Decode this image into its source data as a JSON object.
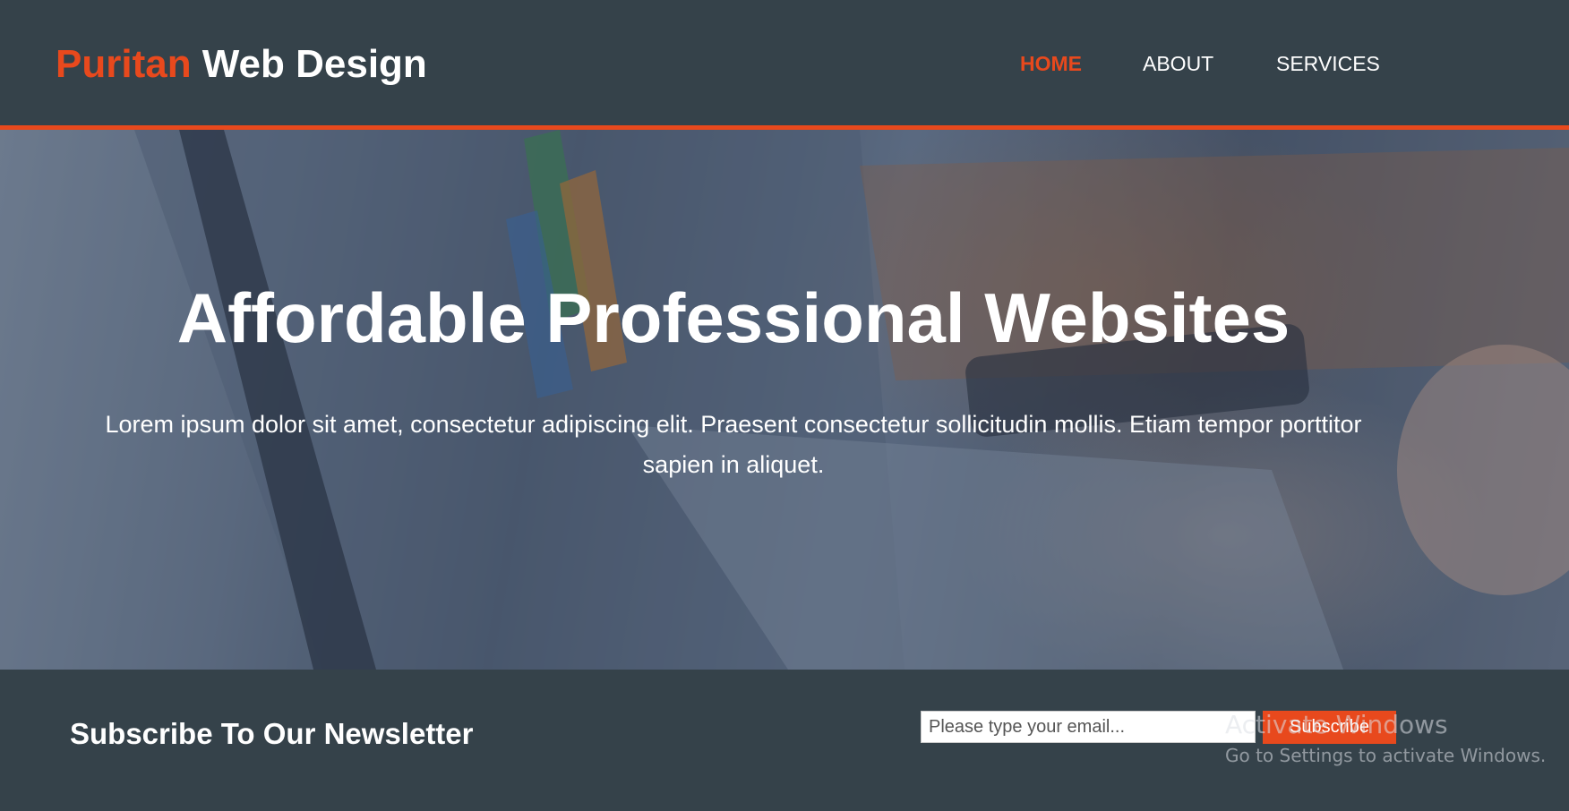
{
  "brand": {
    "highlight": "Puritan",
    "rest": " Web Design"
  },
  "nav": {
    "items": [
      {
        "label": "HOME",
        "current": true
      },
      {
        "label": "ABOUT",
        "current": false
      },
      {
        "label": "SERVICES",
        "current": false
      }
    ]
  },
  "showcase": {
    "title": "Affordable Professional Websites",
    "text": "Lorem ipsum dolor sit amet, consectetur adipiscing elit. Praesent consectetur sollicitudin mollis. Etiam tempor porttitor sapien in aliquet."
  },
  "newsletter": {
    "heading": "Subscribe To Our Newsletter",
    "email_placeholder": "Please type your email...",
    "email_value": "",
    "button_label": "Subscribe"
  },
  "os_watermark": {
    "title": "Activate Windows",
    "subtitle": "Go to Settings to activate Windows."
  },
  "colors": {
    "header_bg": "#35424a",
    "accent": "#e8491d",
    "text_light": "#ffffff"
  },
  "icons": {
    "background_image": "laptop-typing-photo"
  }
}
